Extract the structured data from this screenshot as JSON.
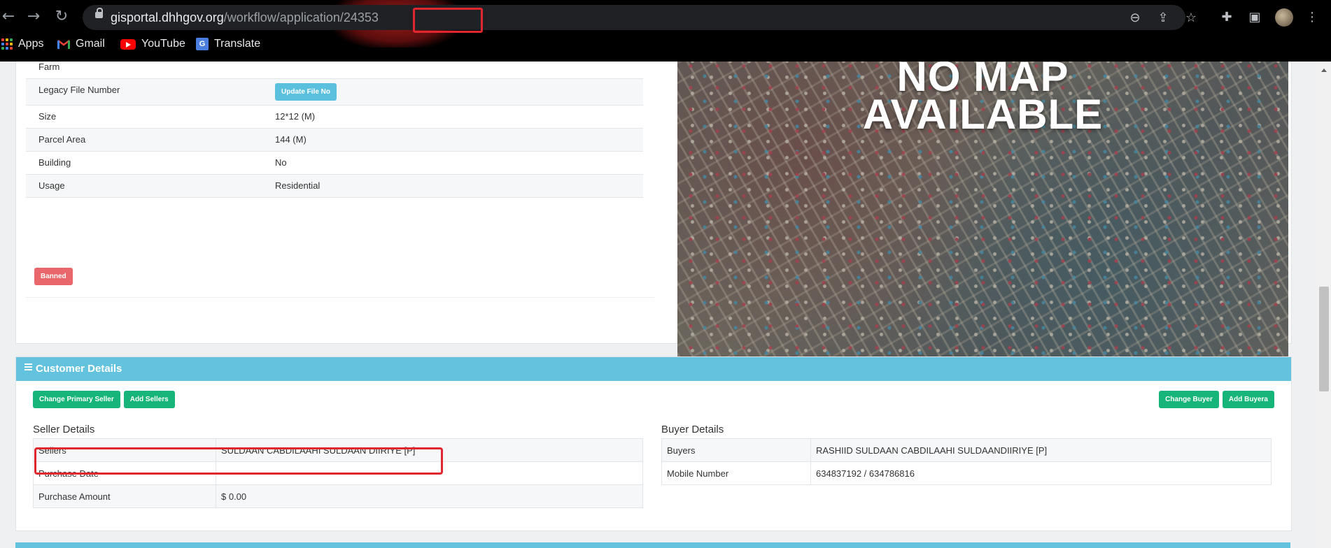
{
  "browser": {
    "url_host": "gisportal.dhhgov.org",
    "url_path": "/workflow/application/24353",
    "bookmarks": [
      {
        "label": "Apps",
        "icon": "apps-grid-icon"
      },
      {
        "label": "Gmail",
        "icon": "gmail-icon"
      },
      {
        "label": "YouTube",
        "icon": "youtube-icon"
      },
      {
        "label": "Translate",
        "icon": "translate-icon"
      }
    ]
  },
  "property": {
    "rows": [
      {
        "label": "Farm",
        "value": ""
      },
      {
        "label": "Legacy File Number",
        "value": ""
      },
      {
        "label": "Size",
        "value": "12*12 (M)"
      },
      {
        "label": "Parcel Area",
        "value": "144 (M)"
      },
      {
        "label": "Building",
        "value": "No"
      },
      {
        "label": "Usage",
        "value": "Residential"
      }
    ],
    "update_file_button": "Update File No",
    "banned_badge": "Banned"
  },
  "map": {
    "line1": "NO MAP",
    "line2": "AVAILABLE"
  },
  "customer": {
    "header": "Customer Details",
    "buttons_left": [
      "Change Primary Seller",
      "Add Sellers"
    ],
    "buttons_right": [
      "Change Buyer",
      "Add Buyera"
    ],
    "seller_title": "Seller Details",
    "seller_rows": [
      {
        "label": "Sellers",
        "value": "SULDAAN CABDILAAHI SULDAAN DIIRIYE [P]"
      },
      {
        "label": "Purchase Date",
        "value": ""
      },
      {
        "label": "Purchase Amount",
        "value": "$ 0.00"
      }
    ],
    "buyer_title": "Buyer Details",
    "buyer_rows": [
      {
        "label": "Buyers",
        "value": "RASHIID SULDAAN CABDILAAHI SULDAANDIIRIYE [P]"
      },
      {
        "label": "Mobile Number",
        "value": "634837192 / 634786816"
      }
    ]
  }
}
